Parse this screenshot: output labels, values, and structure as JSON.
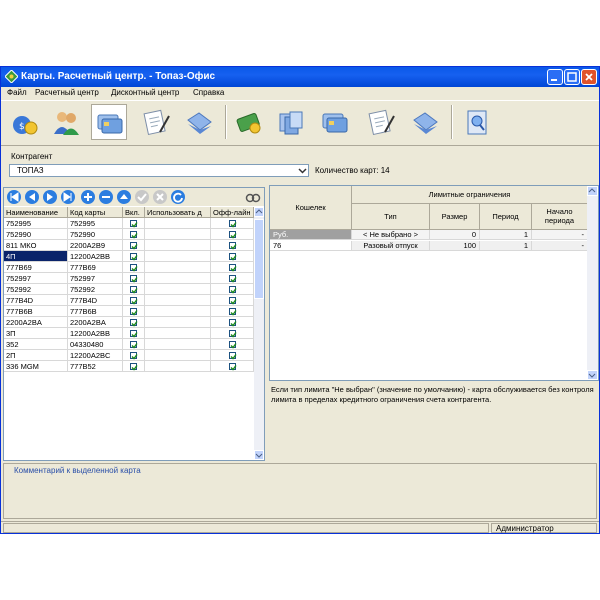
{
  "window": {
    "title": "Карты. Расчетный центр. - Топаз-Офис"
  },
  "menu": [
    "Файл",
    "Расчетный центр",
    "Дисконтный центр",
    "Справка"
  ],
  "toolbar": {
    "icons": [
      "money-bag-icon",
      "users-icon",
      "cards-icon",
      "document-edit-icon",
      "notebook-icon",
      "card-coins-icon",
      "card-stack-icon",
      "cards-icon",
      "document-edit-icon",
      "notebook-icon",
      "report-search-icon"
    ],
    "active_index": 2
  },
  "contragent": {
    "label": "Контрагент",
    "value": "ТОПАЗ",
    "count_label": "Количество карт: 14"
  },
  "nav_icons": [
    "first-icon",
    "prev-icon",
    "next-icon",
    "last-icon",
    "add-icon",
    "delete-icon",
    "up-icon",
    "confirm-icon",
    "cancel-icon",
    "refresh-icon",
    "filter-icon"
  ],
  "cards_table": {
    "headers": [
      "Наименование",
      "Код карты",
      "Вкл.",
      "Использовать д",
      "Офф-лайн"
    ],
    "rows": [
      {
        "name": "752995",
        "code": "752995",
        "enabled": true,
        "use": false,
        "offline": true
      },
      {
        "name": "752990",
        "code": "752990",
        "enabled": true,
        "use": false,
        "offline": true
      },
      {
        "name": "811 МКО",
        "code": "2200A2B9",
        "enabled": true,
        "use": false,
        "offline": true
      },
      {
        "name": "4П",
        "code": "12200A2BB",
        "enabled": true,
        "use": false,
        "offline": true,
        "selected": true
      },
      {
        "name": "777B69",
        "code": "777B69",
        "enabled": true,
        "use": false,
        "offline": true
      },
      {
        "name": "752997",
        "code": "752997",
        "enabled": true,
        "use": false,
        "offline": true
      },
      {
        "name": "752992",
        "code": "752992",
        "enabled": true,
        "use": false,
        "offline": true
      },
      {
        "name": "777B4D",
        "code": "777B4D",
        "enabled": true,
        "use": false,
        "offline": true
      },
      {
        "name": "777B6B",
        "code": "777B6B",
        "enabled": true,
        "use": false,
        "offline": true
      },
      {
        "name": "2200A2BA",
        "code": "2200A2BA",
        "enabled": true,
        "use": false,
        "offline": true
      },
      {
        "name": "3П",
        "code": "12200A2BB",
        "enabled": true,
        "use": false,
        "offline": true
      },
      {
        "name": "352",
        "code": "04330480",
        "enabled": true,
        "use": false,
        "offline": true
      },
      {
        "name": "2П",
        "code": "12200A2BC",
        "enabled": true,
        "use": false,
        "offline": true
      },
      {
        "name": "336 MGM",
        "code": "777B52",
        "enabled": true,
        "use": false,
        "offline": true
      }
    ]
  },
  "limits_table": {
    "wallet_header": "Кошелек",
    "group_header": "Лимитные ограничения",
    "headers": [
      "Тип",
      "Размер",
      "Период",
      "Начало периода"
    ],
    "rows": [
      {
        "wallet": "Руб.",
        "type": "< Не выбрано >",
        "size": "0",
        "period": "1",
        "start": "-"
      },
      {
        "wallet": "76",
        "type": "Разовый отпуск",
        "size": "100",
        "period": "1",
        "start": "-"
      }
    ]
  },
  "note": "Если тип лимита \"Не выбран\" (значение по умолчанию) - карта обслуживается без контроля лимита в пределах кредитного ограничения счета контрагента.",
  "comment_label": "Комментарий к выделенной карта",
  "status": {
    "user": "Администратор"
  },
  "colors": {
    "title_bar": "#0a58e8",
    "nav_button": "#2b7de0",
    "check": "#1c8a1c",
    "selection": "#0a246a"
  }
}
